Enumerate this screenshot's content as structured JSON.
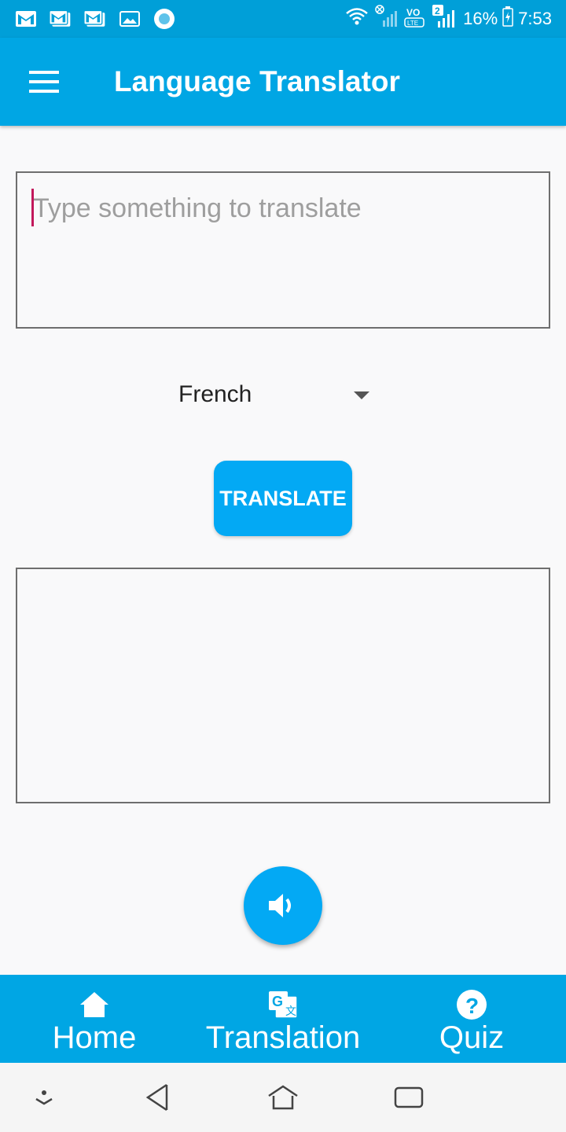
{
  "status_bar": {
    "battery": "16%",
    "time": "7:53",
    "sim_badge": "2",
    "volte": "VO LTE",
    "icons": [
      "gmail-icon",
      "gmail-icon",
      "gmail-icon",
      "gallery-icon",
      "circle-notification-icon",
      "wifi-icon",
      "signal-icon",
      "volte-icon",
      "signal-icon",
      "battery-icon"
    ]
  },
  "app_bar": {
    "title": "Language Translator",
    "menu_icon": "hamburger-menu-icon"
  },
  "input": {
    "placeholder": "Type something to translate",
    "value": ""
  },
  "language_selector": {
    "selected": "French"
  },
  "translate_button": {
    "label": "TRANSLATE"
  },
  "output": {
    "value": ""
  },
  "speak_button": {
    "icon": "speaker-icon"
  },
  "bottom_nav": {
    "items": [
      {
        "label": "Home",
        "icon": "home-icon"
      },
      {
        "label": "Translation",
        "icon": "translate-icon"
      },
      {
        "label": "Quiz",
        "icon": "help-circle-icon"
      }
    ]
  },
  "colors": {
    "status_bar": "#009fd8",
    "primary": "#00a6e4",
    "accent": "#03a9f4",
    "caret": "#c2185b",
    "background": "#f9f9fa"
  }
}
